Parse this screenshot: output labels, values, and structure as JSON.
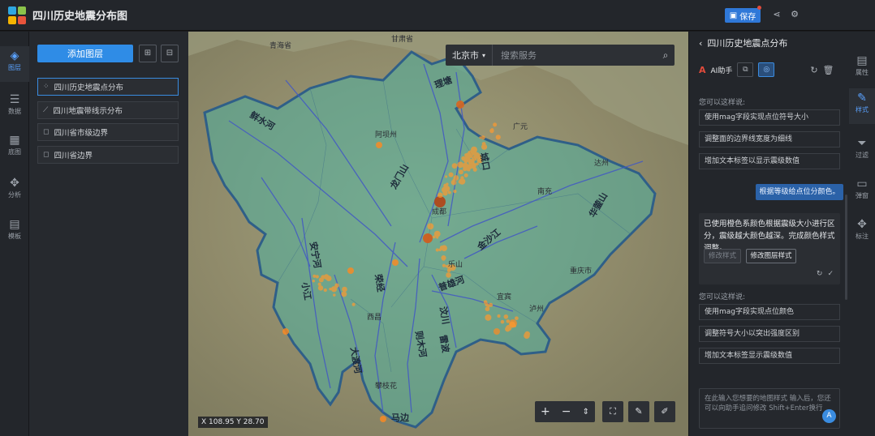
{
  "app": {
    "title": "四川历史地震分布图",
    "save_label": "保存",
    "colors": {
      "accent": "#2f8ce6",
      "save": "#2f78d8",
      "quake": "#ff8a1f",
      "province_fill": "#4fb0a0"
    }
  },
  "left_rail": [
    {
      "icon": "layers-icon",
      "label": "图层",
      "active": true
    },
    {
      "icon": "database-icon",
      "label": "数据",
      "active": false
    },
    {
      "icon": "map-icon",
      "label": "底图",
      "active": false
    },
    {
      "icon": "analysis-icon",
      "label": "分析",
      "active": false
    },
    {
      "icon": "module-icon",
      "label": "模板",
      "active": false
    }
  ],
  "layer_panel": {
    "add_label": "添加图层",
    "layers": [
      {
        "icon": "point-layer-icon",
        "name": "四川历史地震点分布",
        "selected": true
      },
      {
        "icon": "line-layer-icon",
        "name": "四川地震带线示分布",
        "selected": false
      },
      {
        "icon": "polygon-layer-icon",
        "name": "四川省市级边界",
        "selected": false
      },
      {
        "icon": "polygon-layer-icon",
        "name": "四川省边界",
        "selected": false
      }
    ]
  },
  "map": {
    "city": "北京市",
    "search_placeholder": "搜索服务",
    "coords": "X 108.95 Y 28.70",
    "fault_labels": [
      "鲜水河",
      "龙门山",
      "安宁河",
      "则木河",
      "小江",
      "金沙江",
      "理塘",
      "荣经",
      "普雄河",
      "大渡河",
      "城口",
      "华蓥山",
      "马边",
      "汶川",
      "雷波"
    ],
    "place_labels": [
      "青海省",
      "甘肃省",
      "阿坝州",
      "成都",
      "重庆市",
      "乐山",
      "宜宾",
      "泸州",
      "西昌",
      "攀枝花",
      "广元",
      "南充",
      "达州"
    ]
  },
  "assistant": {
    "title": "四川历史地震点分布",
    "ai_label": "AI助手",
    "tools": [
      "copy-icon",
      "style-icon"
    ],
    "suggest_header_1": "您可以这样说:",
    "suggestions_1": [
      "使用mag字段实现点位符号大小",
      "调整面的边界线宽度为细线",
      "增加文本标签以显示震级数值"
    ],
    "user_message": "根据等级给点位分颜色。",
    "response_text": "已使用橙色系颜色根据震级大小进行区分，震级越大颜色越深。完成颜色样式调整。",
    "chip_disabled": "修改样式",
    "chip_action": "修改图层样式",
    "suggest_header_2": "您可以这样说:",
    "suggestions_2": [
      "使用mag字段实现点位颜色",
      "调整符号大小以突出强度区别",
      "增加文本标签显示震级数值"
    ],
    "input_placeholder": "在此输入您想要的地图样式 输入后，您还可以向助手追问修改 Shift+Enter换行"
  },
  "right_rail": [
    {
      "icon": "attribute-icon",
      "label": "属性",
      "active": false
    },
    {
      "icon": "style-brush-icon",
      "label": "样式",
      "active": true
    },
    {
      "icon": "filter-icon",
      "label": "过滤",
      "active": false
    },
    {
      "icon": "popup-icon",
      "label": "弹窗",
      "active": false
    },
    {
      "icon": "label-icon",
      "label": "标注",
      "active": false
    }
  ]
}
